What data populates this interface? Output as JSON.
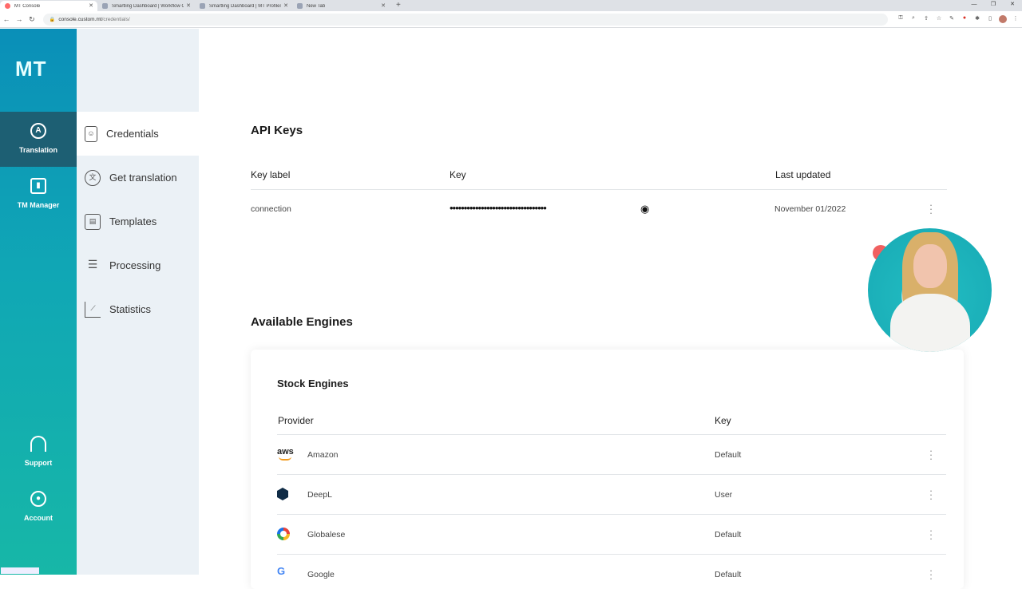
{
  "browser": {
    "tabs": [
      {
        "title": "MT Console",
        "active": true
      },
      {
        "title": "Smartling Dashboard | Workflow Ov",
        "active": false
      },
      {
        "title": "Smartling Dashboard | MT Profiles",
        "active": false
      },
      {
        "title": "New Tab",
        "active": false
      }
    ],
    "url_host": "console.custom.mt",
    "url_path": "/credentials/"
  },
  "rail": {
    "logo": "MT",
    "items": [
      {
        "label": "Translation",
        "icon": "translation-icon"
      },
      {
        "label": "TM Manager",
        "icon": "bar-chart-icon"
      },
      {
        "label": "Support",
        "icon": "headset-icon"
      },
      {
        "label": "Account",
        "icon": "user-circle-icon"
      }
    ]
  },
  "submenu": {
    "items": [
      {
        "label": "Credentials",
        "icon": "id-badge-icon"
      },
      {
        "label": "Get translation",
        "icon": "translate-icon"
      },
      {
        "label": "Templates",
        "icon": "layout-icon"
      },
      {
        "label": "Processing",
        "icon": "sliders-icon"
      },
      {
        "label": "Statistics",
        "icon": "line-chart-icon"
      }
    ]
  },
  "api_keys": {
    "title": "API Keys",
    "headers": {
      "label": "Key label",
      "key": "Key",
      "updated": "Last updated"
    },
    "rows": [
      {
        "label": "connection",
        "key": "••••••••••••••••••••••••••••••••••",
        "updated": "November 01/2022"
      }
    ]
  },
  "engines": {
    "title": "Available Engines",
    "card_title": "Stock Engines",
    "headers": {
      "provider": "Provider",
      "key": "Key"
    },
    "rows": [
      {
        "name": "Amazon",
        "key": "Default",
        "logo": "aws"
      },
      {
        "name": "DeepL",
        "key": "User"
      },
      {
        "name": "Globalese",
        "key": "Default"
      },
      {
        "name": "Google",
        "key": "Default"
      }
    ]
  },
  "colors": {
    "rail_gradient_top": "#0a8fb8",
    "rail_gradient_bottom": "#17b7a7",
    "rail_active": "#1d5f73",
    "submenu_bg": "#ebf1f6"
  }
}
